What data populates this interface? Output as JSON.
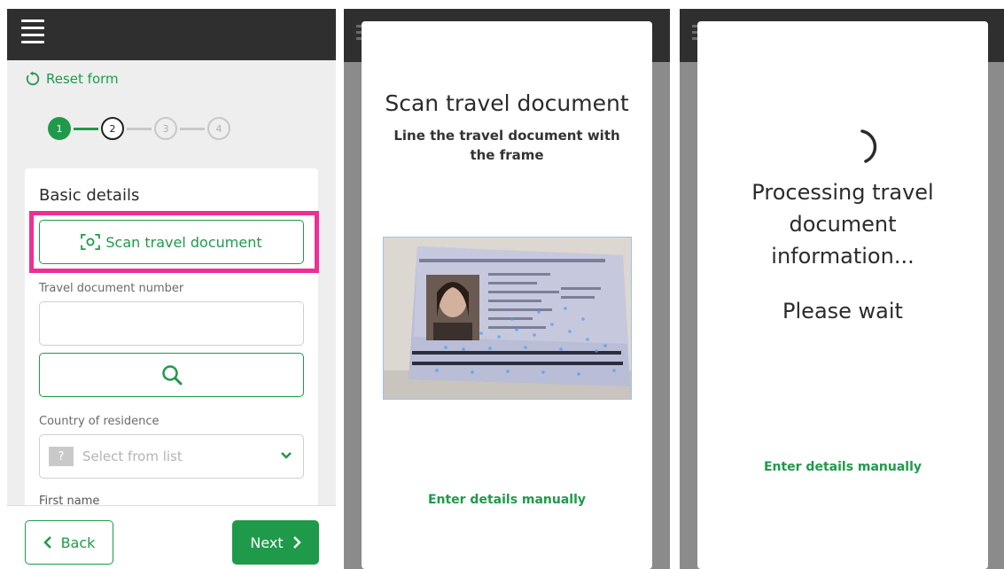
{
  "form": {
    "reset_label": "Reset form",
    "steps": [
      "1",
      "2",
      "3",
      "4"
    ],
    "section_title": "Basic details",
    "scan_button_label": "Scan travel document",
    "travel_doc_label": "Travel document number",
    "travel_doc_value": "",
    "country_label": "Country of residence",
    "country_badge": "?",
    "country_placeholder": "Select from list",
    "first_name_label": "First name",
    "back_label": "Back",
    "next_label": "Next"
  },
  "scan_modal": {
    "title": "Scan travel document",
    "subtitle": "Line the travel document with the frame",
    "manual_link": "Enter details manually"
  },
  "processing_modal": {
    "message": "Processing travel document information...",
    "wait": "Please wait",
    "manual_link": "Enter details manually"
  },
  "colors": {
    "accent": "#1f9a4a",
    "highlight": "#ee2f95",
    "topbar": "#2f2f2f"
  },
  "icons": [
    "menu-icon",
    "reset-icon",
    "scan-icon",
    "search-icon",
    "chevron-down-icon",
    "chevron-left-icon",
    "chevron-right-icon",
    "spinner-icon"
  ]
}
